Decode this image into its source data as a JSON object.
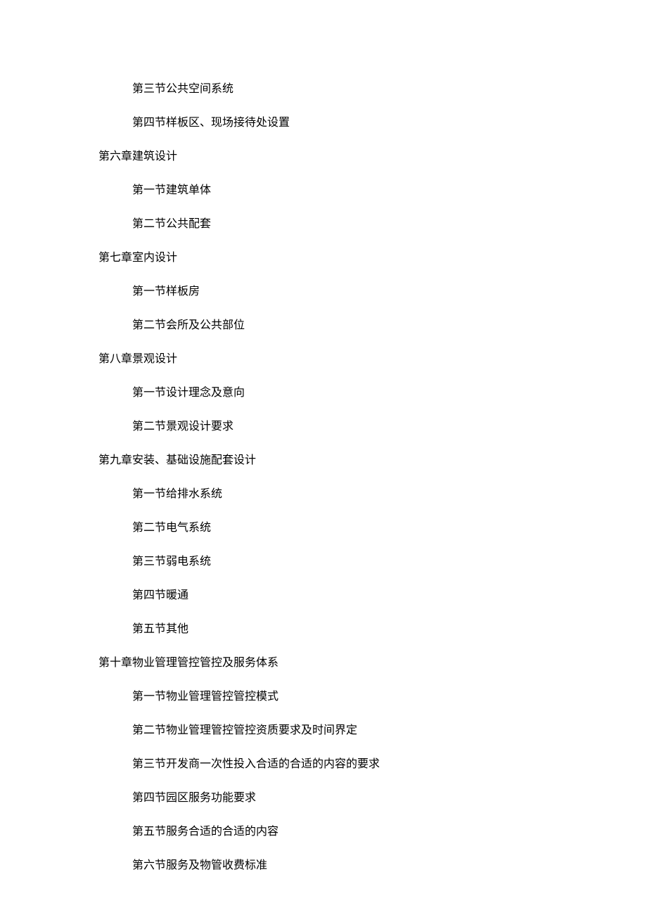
{
  "toc": [
    {
      "level": 2,
      "text": "第三节公共空间系统"
    },
    {
      "level": 2,
      "text": "第四节样板区、现场接待处设置"
    },
    {
      "level": 1,
      "text": "第六章建筑设计"
    },
    {
      "level": 2,
      "text": "第一节建筑单体"
    },
    {
      "level": 2,
      "text": "第二节公共配套"
    },
    {
      "level": 1,
      "text": "第七章室内设计"
    },
    {
      "level": 2,
      "text": "第一节样板房"
    },
    {
      "level": 2,
      "text": "第二节会所及公共部位"
    },
    {
      "level": 1,
      "text": "第八章景观设计"
    },
    {
      "level": 2,
      "text": "第一节设计理念及意向"
    },
    {
      "level": 2,
      "text": "第二节景观设计要求"
    },
    {
      "level": 1,
      "text": "第九章安装、基础设施配套设计"
    },
    {
      "level": 2,
      "text": "第一节给排水系统"
    },
    {
      "level": 2,
      "text": "第二节电气系统"
    },
    {
      "level": 2,
      "text": "第三节弱电系统"
    },
    {
      "level": 2,
      "text": "第四节暖通"
    },
    {
      "level": 2,
      "text": "第五节其他"
    },
    {
      "level": 1,
      "text": "第十章物业管理管控管控及服务体系"
    },
    {
      "level": 2,
      "text": "第一节物业管理管控管控模式"
    },
    {
      "level": 2,
      "text": "第二节物业管理管控管控资质要求及时间界定"
    },
    {
      "level": 2,
      "text": "第三节开发商一次性投入合适的合适的内容的要求"
    },
    {
      "level": 2,
      "text": "第四节园区服务功能要求"
    },
    {
      "level": 2,
      "text": "第五节服务合适的合适的内容"
    },
    {
      "level": 2,
      "text": "第六节服务及物管收费标准"
    }
  ]
}
